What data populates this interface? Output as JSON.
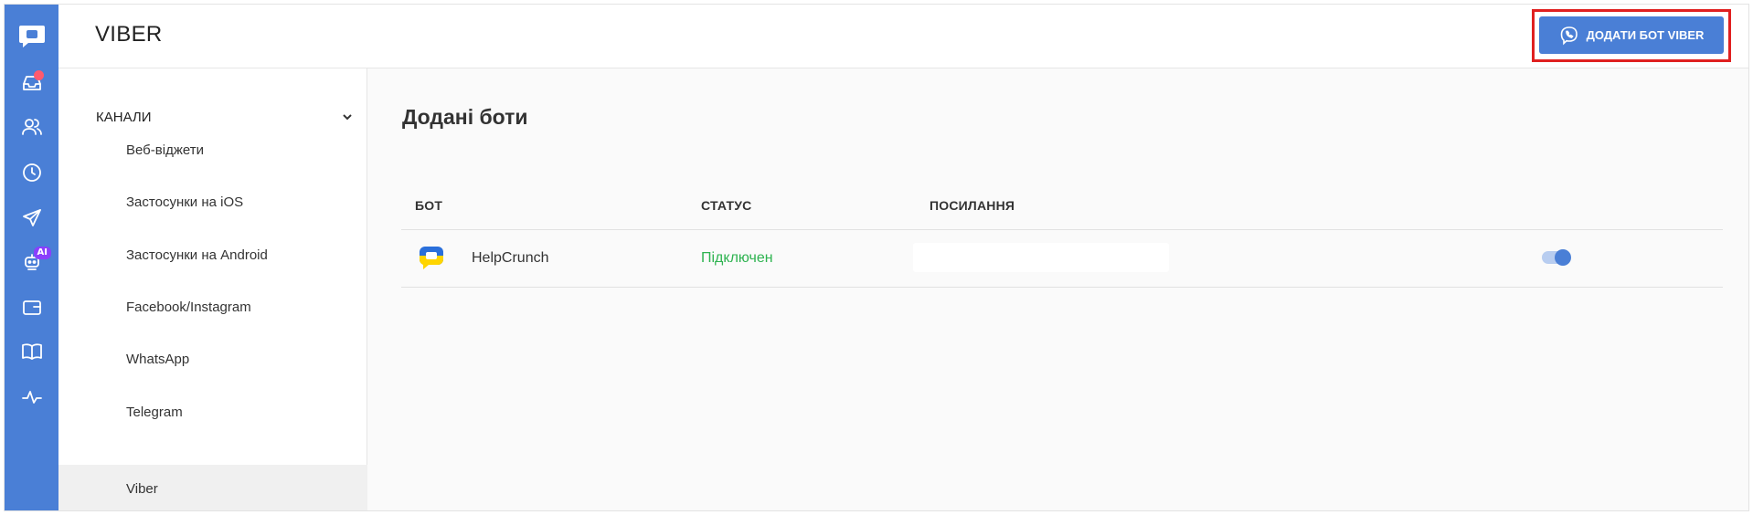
{
  "header": {
    "title": "VIBER",
    "add_button_label": "ДОДАТИ БОТ VIBER"
  },
  "rail": {
    "accent": "#4a7fd6",
    "items": [
      {
        "icon": "chat-logo-icon"
      },
      {
        "icon": "inbox-icon",
        "notification_dot": true
      },
      {
        "icon": "contacts-icon"
      },
      {
        "icon": "clock-icon"
      },
      {
        "icon": "send-icon"
      },
      {
        "icon": "robot-icon",
        "badge": "AI"
      },
      {
        "icon": "wallet-icon"
      },
      {
        "icon": "book-icon"
      },
      {
        "icon": "pulse-icon"
      }
    ]
  },
  "subnav": {
    "section_label": "КАНАЛИ",
    "items": [
      {
        "label": "Веб-віджети"
      },
      {
        "label": "Застосунки на iOS"
      },
      {
        "label": "Застосунки на Android"
      },
      {
        "label": "Facebook/Instagram"
      },
      {
        "label": "WhatsApp"
      },
      {
        "label": "Telegram"
      },
      {
        "label": "Viber",
        "active": true
      }
    ]
  },
  "main": {
    "title": "Додані боти",
    "columns": [
      "БОТ",
      "СТАТУС",
      "ПОСИЛАННЯ"
    ],
    "rows": [
      {
        "name": "HelpCrunch",
        "status": "Підключен",
        "link": "",
        "enabled": true
      }
    ],
    "status_color": "#2eb350"
  }
}
